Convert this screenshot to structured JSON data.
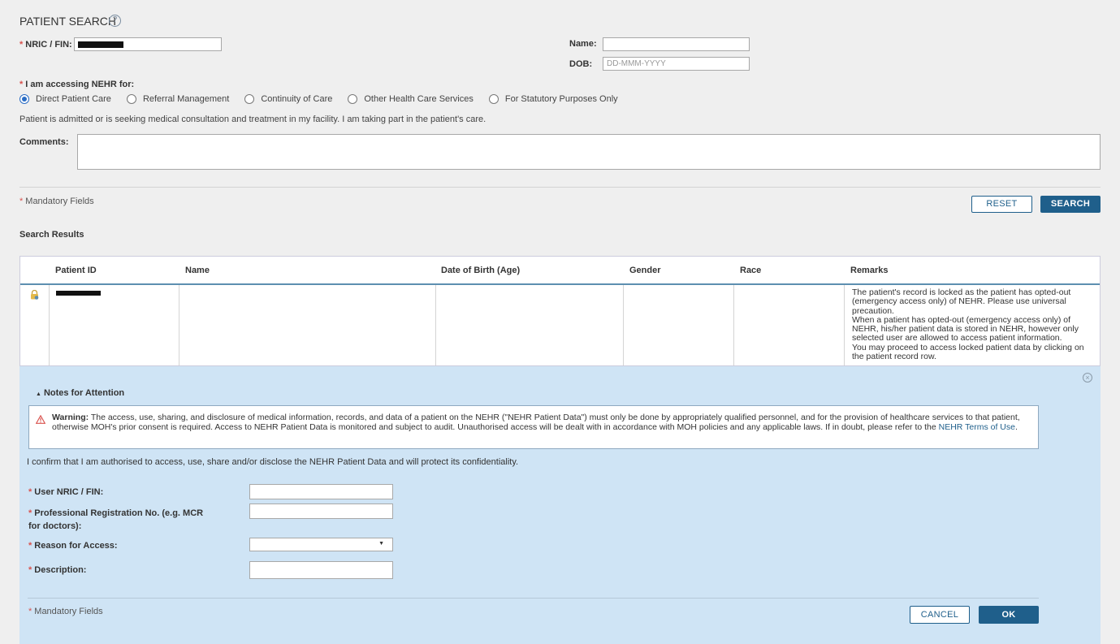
{
  "page": {
    "title": "PATIENT SEARCH",
    "help_symbol": "?"
  },
  "search_form": {
    "nric_label": "NRIC / FIN:",
    "name_label": "Name:",
    "dob_label": "DOB:",
    "dob_placeholder": "DD-MMM-YYYY",
    "accessing_label": "I am accessing NEHR for:",
    "options": [
      {
        "label": "Direct Patient Care",
        "selected": true
      },
      {
        "label": "Referral Management",
        "selected": false
      },
      {
        "label": "Continuity of Care",
        "selected": false
      },
      {
        "label": "Other Health Care Services",
        "selected": false
      },
      {
        "label": "For Statutory Purposes Only",
        "selected": false
      }
    ],
    "option_description": "Patient is admitted or is seeking medical consultation and treatment in my facility. I am taking part in the patient's care.",
    "comments_label": "Comments:",
    "mandatory_note": "Mandatory Fields",
    "reset_label": "RESET",
    "search_label": "SEARCH"
  },
  "results": {
    "heading": "Search Results",
    "columns": [
      "Patient ID",
      "Name",
      "Date of Birth (Age)",
      "Gender",
      "Race",
      "Remarks"
    ],
    "row_remarks": "The patient's record is locked as the patient has opted-out (emergency access only) of NEHR. Please use universal precaution.\nWhen a patient has opted-out (emergency access only) of NEHR, his/her patient data is stored in NEHR, however  only selected user are allowed to access patient information.\nYou may proceed to access locked patient data by clicking on the patient record row."
  },
  "notes": {
    "title": "Notes for Attention",
    "warning_label": "Warning:",
    "warning_text": " The access, use, sharing, and disclosure of medical information, records, and data of a patient on the NEHR (\"NEHR Patient Data\") must only be done by appropriately qualified personnel, and for the provision of healthcare services to that patient, otherwise MOH's prior consent is required. Access to NEHR Patient Data is monitored and subject to audit. Unauthorised access will be dealt with in accordance with MOH policies and any applicable laws. If in doubt, please refer to the ",
    "warning_link": "NEHR Terms of Use",
    "warning_end": ".",
    "confirm_text": "I confirm that I am authorised to access, use, share and/or disclose the NEHR Patient Data and will protect its confidentiality.",
    "user_nric_label": "User NRIC / FIN:",
    "prof_reg_label": "Professional Registration No. (e.g. MCR for doctors):",
    "reason_label": "Reason for Access:",
    "description_label": "Description:",
    "mandatory_note": "Mandatory Fields",
    "cancel_label": "CANCEL",
    "ok_label": "OK"
  },
  "colors": {
    "primary": "#1f5f8b",
    "modal_bg": "#cfe4f5",
    "required": "#d9534f"
  },
  "icons": [
    "help-icon",
    "lock-icon",
    "close-icon",
    "warning-icon",
    "caret-up-icon",
    "dropdown-arrow-icon"
  ]
}
